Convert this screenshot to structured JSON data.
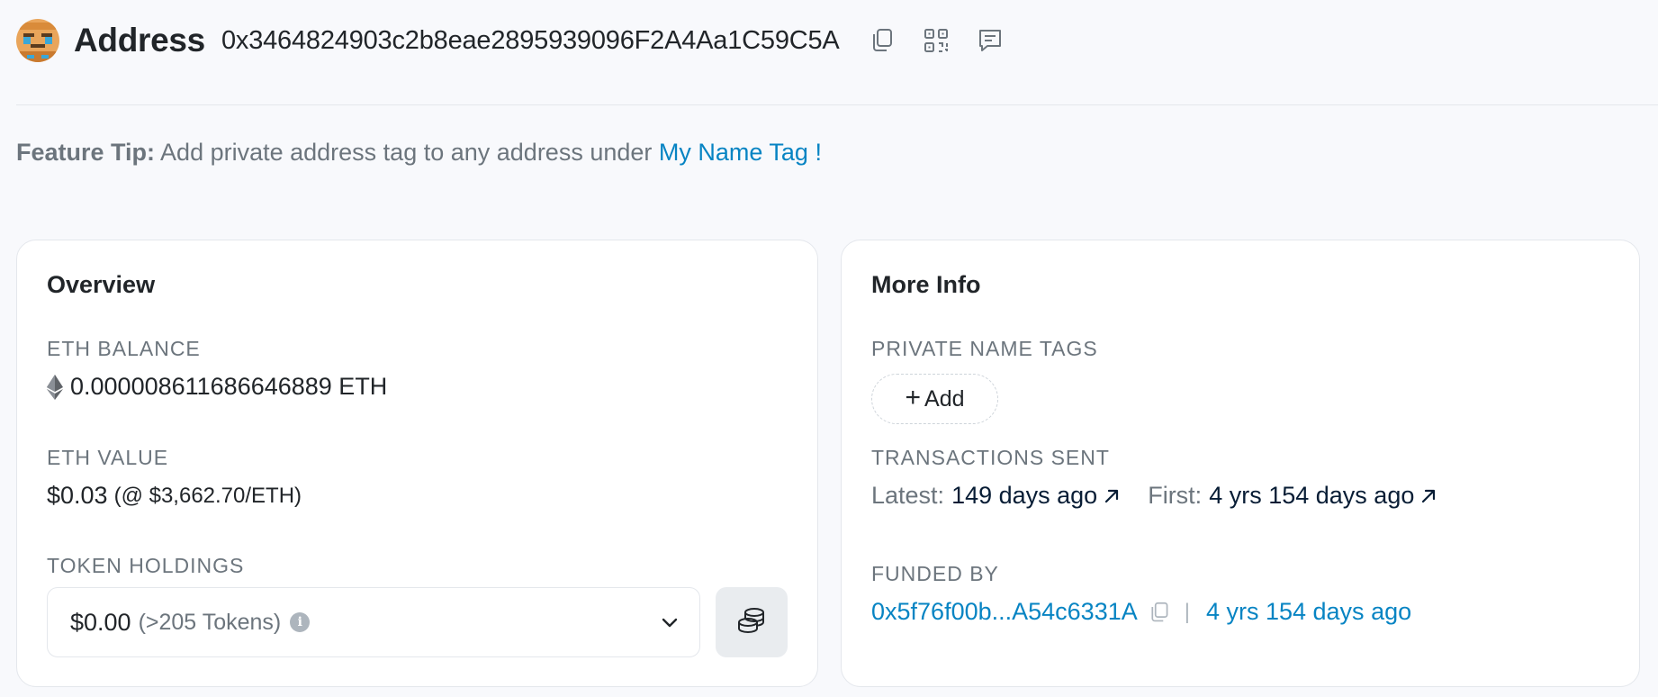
{
  "header": {
    "title": "Address",
    "address": "0x3464824903c2b8eae2895939096F2A4Aa1C59C5A",
    "icons": [
      "copy-icon",
      "qr-code-icon",
      "comment-icon"
    ]
  },
  "tip": {
    "label": "Feature Tip:",
    "text": " Add private address tag to any address under ",
    "link": "My Name Tag !"
  },
  "overview": {
    "title": "Overview",
    "eth_balance_label": "ETH BALANCE",
    "eth_balance_value": "0.000008611686646889 ETH",
    "eth_value_label": "ETH VALUE",
    "eth_value": "$0.03",
    "eth_price": "(@ $3,662.70/ETH)",
    "token_holdings_label": "TOKEN HOLDINGS",
    "token_amount": "$0.00",
    "token_count": "(>205 Tokens)",
    "info_glyph": "i"
  },
  "more_info": {
    "title": "More Info",
    "private_tags_label": "PRIVATE NAME TAGS",
    "add_label": "Add",
    "add_glyph": "+",
    "tx_sent_label": "TRANSACTIONS SENT",
    "latest_label": "Latest:",
    "latest_value": "149 days ago",
    "first_label": "First:",
    "first_value": "4 yrs 154 days ago",
    "funded_by_label": "FUNDED BY",
    "funded_by_address": "0x5f76f00b...A54c6331A",
    "separator": "|",
    "funded_by_age": "4 yrs 154 days ago"
  },
  "colors": {
    "link": "#0784c3",
    "muted": "#6c757d",
    "text": "#212529",
    "border": "#e4e7ec"
  }
}
